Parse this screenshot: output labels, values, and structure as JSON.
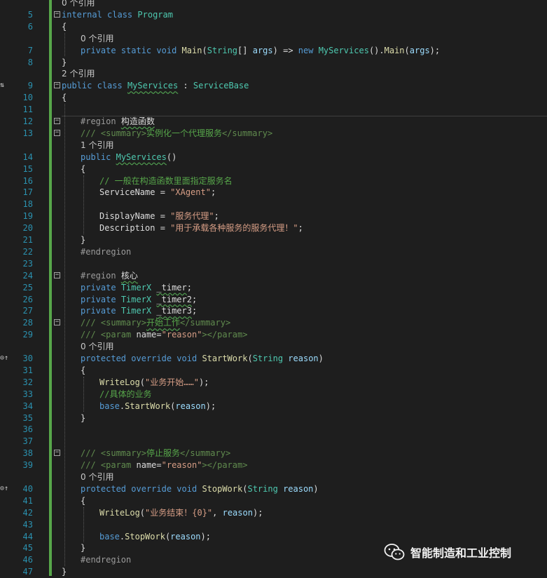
{
  "colors": {
    "background": "#1e1e1e",
    "line_number": "#2b91af",
    "keyword": "#569cd6",
    "type": "#4ec9b0",
    "plain": "#dcdcdc",
    "string": "#d69d85",
    "comment": "#57a64a",
    "xmldoc_tag": "#608b4e",
    "preprocessor": "#9b9b9b",
    "reference_hint": "#c8c8c8",
    "param": "#9cdcfe",
    "method": "#dcdcaa",
    "change_bar": "#57a64a"
  },
  "editor": {
    "gutter_markers": [
      {
        "row": 7,
        "text": "⇅"
      },
      {
        "row": 30,
        "text": "⊙↑"
      },
      {
        "row": 41,
        "text": "⊙↑"
      }
    ],
    "lines": [
      {
        "ln": "",
        "fold": "",
        "indent": 0,
        "tokens": [
          {
            "t": "0 个引用",
            "c": "ref"
          }
        ]
      },
      {
        "ln": "5",
        "fold": "−",
        "indent": 0,
        "tokens": [
          {
            "t": "internal",
            "c": "kw"
          },
          {
            "t": " "
          },
          {
            "t": "class",
            "c": "kw"
          },
          {
            "t": " "
          },
          {
            "t": "Program",
            "c": "type"
          }
        ]
      },
      {
        "ln": "6",
        "fold": "",
        "indent": 0,
        "tokens": [
          {
            "t": "{"
          }
        ]
      },
      {
        "ln": "",
        "fold": "",
        "indent": 1,
        "tokens": [
          {
            "t": "0 个引用",
            "c": "ref"
          }
        ]
      },
      {
        "ln": "7",
        "fold": "",
        "indent": 1,
        "tokens": [
          {
            "t": "private",
            "c": "kw"
          },
          {
            "t": " "
          },
          {
            "t": "static",
            "c": "kw"
          },
          {
            "t": " "
          },
          {
            "t": "void",
            "c": "kw"
          },
          {
            "t": " "
          },
          {
            "t": "Main",
            "c": "method"
          },
          {
            "t": "("
          },
          {
            "t": "String",
            "c": "type"
          },
          {
            "t": "[] "
          },
          {
            "t": "args",
            "c": "param"
          },
          {
            "t": ") => "
          },
          {
            "t": "new",
            "c": "kw"
          },
          {
            "t": " "
          },
          {
            "t": "MyServices",
            "c": "type"
          },
          {
            "t": "()."
          },
          {
            "t": "Main",
            "c": "method"
          },
          {
            "t": "("
          },
          {
            "t": "args",
            "c": "param"
          },
          {
            "t": ");"
          }
        ]
      },
      {
        "ln": "8",
        "fold": "",
        "indent": 0,
        "tokens": [
          {
            "t": "}"
          }
        ]
      },
      {
        "ln": "",
        "fold": "",
        "indent": 0,
        "tokens": [
          {
            "t": "2 个引用",
            "c": "ref"
          }
        ]
      },
      {
        "ln": "9",
        "fold": "−",
        "indent": 0,
        "tokens": [
          {
            "t": "public",
            "c": "kw"
          },
          {
            "t": " "
          },
          {
            "t": "class",
            "c": "kw"
          },
          {
            "t": " "
          },
          {
            "t": "MyServices",
            "c": "type squiggle"
          },
          {
            "t": " : "
          },
          {
            "t": "ServiceBase",
            "c": "type"
          }
        ]
      },
      {
        "ln": "10",
        "fold": "",
        "indent": 0,
        "tokens": [
          {
            "t": "{"
          }
        ]
      },
      {
        "ln": "11",
        "fold": "",
        "indent": 0,
        "tokens": []
      },
      {
        "ln": "12",
        "fold": "−",
        "indent": 1,
        "tokens": [
          {
            "t": "#region",
            "c": "pre"
          },
          {
            "t": " "
          },
          {
            "t": "构造函数",
            "c": "plain squiggle"
          }
        ]
      },
      {
        "ln": "13",
        "fold": "−",
        "indent": 1,
        "tokens": [
          {
            "t": "/// ",
            "c": "xml"
          },
          {
            "t": "<summary>",
            "c": "xml"
          },
          {
            "t": "实例化一个代理服务",
            "c": "comment"
          },
          {
            "t": "</summary>",
            "c": "xml"
          }
        ]
      },
      {
        "ln": "",
        "fold": "",
        "indent": 1,
        "tokens": [
          {
            "t": "1 个引用",
            "c": "ref"
          }
        ]
      },
      {
        "ln": "14",
        "fold": "",
        "indent": 1,
        "tokens": [
          {
            "t": "public",
            "c": "kw"
          },
          {
            "t": " "
          },
          {
            "t": "MyServices",
            "c": "type squiggle"
          },
          {
            "t": "()"
          }
        ]
      },
      {
        "ln": "15",
        "fold": "",
        "indent": 1,
        "tokens": [
          {
            "t": "{"
          }
        ]
      },
      {
        "ln": "16",
        "fold": "",
        "indent": 2,
        "tokens": [
          {
            "t": "// 一般在构造函数里面指定服务名",
            "c": "comment"
          }
        ]
      },
      {
        "ln": "17",
        "fold": "",
        "indent": 2,
        "tokens": [
          {
            "t": "ServiceName = "
          },
          {
            "t": "\"XAgent\"",
            "c": "str"
          },
          {
            "t": ";"
          }
        ]
      },
      {
        "ln": "18",
        "fold": "",
        "indent": 2,
        "tokens": []
      },
      {
        "ln": "19",
        "fold": "",
        "indent": 2,
        "tokens": [
          {
            "t": "DisplayName = "
          },
          {
            "t": "\"服务代理\"",
            "c": "str"
          },
          {
            "t": ";"
          }
        ]
      },
      {
        "ln": "20",
        "fold": "",
        "indent": 2,
        "tokens": [
          {
            "t": "Description = "
          },
          {
            "t": "\"用于承载各种服务的服务代理！\"",
            "c": "str"
          },
          {
            "t": ";"
          }
        ]
      },
      {
        "ln": "21",
        "fold": "",
        "indent": 1,
        "tokens": [
          {
            "t": "}"
          }
        ]
      },
      {
        "ln": "22",
        "fold": "",
        "indent": 1,
        "tokens": [
          {
            "t": "#endregion",
            "c": "pre"
          }
        ]
      },
      {
        "ln": "23",
        "fold": "",
        "indent": 1,
        "tokens": []
      },
      {
        "ln": "24",
        "fold": "−",
        "indent": 1,
        "tokens": [
          {
            "t": "#region",
            "c": "pre"
          },
          {
            "t": " "
          },
          {
            "t": "核心",
            "c": "plain squiggle"
          }
        ]
      },
      {
        "ln": "25",
        "fold": "",
        "indent": 1,
        "tokens": [
          {
            "t": "private",
            "c": "kw"
          },
          {
            "t": " "
          },
          {
            "t": "TimerX",
            "c": "type"
          },
          {
            "t": " "
          },
          {
            "t": "_timer",
            "c": "plain squiggle"
          },
          {
            "t": ";"
          }
        ]
      },
      {
        "ln": "26",
        "fold": "",
        "indent": 1,
        "tokens": [
          {
            "t": "private",
            "c": "kw"
          },
          {
            "t": " "
          },
          {
            "t": "TimerX",
            "c": "type"
          },
          {
            "t": " "
          },
          {
            "t": "_timer2",
            "c": "plain squiggle"
          },
          {
            "t": ";"
          }
        ]
      },
      {
        "ln": "27",
        "fold": "",
        "indent": 1,
        "tokens": [
          {
            "t": "private",
            "c": "kw"
          },
          {
            "t": " "
          },
          {
            "t": "TimerX",
            "c": "type"
          },
          {
            "t": " "
          },
          {
            "t": "_timer3",
            "c": "plain squiggle"
          },
          {
            "t": ";"
          }
        ]
      },
      {
        "ln": "28",
        "fold": "−",
        "indent": 1,
        "tokens": [
          {
            "t": "/// ",
            "c": "xml"
          },
          {
            "t": "<summary>",
            "c": "xml"
          },
          {
            "t": "开始工作",
            "c": "comment squiggle"
          },
          {
            "t": "</summary>",
            "c": "xml"
          }
        ]
      },
      {
        "ln": "29",
        "fold": "",
        "indent": 1,
        "tokens": [
          {
            "t": "/// ",
            "c": "xml"
          },
          {
            "t": "<param",
            "c": "xml"
          },
          {
            "t": " name=",
            "c": "plain"
          },
          {
            "t": "\"reason\"",
            "c": "str"
          },
          {
            "t": "></param>",
            "c": "xml"
          }
        ]
      },
      {
        "ln": "",
        "fold": "",
        "indent": 1,
        "tokens": [
          {
            "t": "0 个引用",
            "c": "ref"
          }
        ]
      },
      {
        "ln": "30",
        "fold": "",
        "indent": 1,
        "tokens": [
          {
            "t": "protected",
            "c": "kw"
          },
          {
            "t": " "
          },
          {
            "t": "override",
            "c": "kw"
          },
          {
            "t": " "
          },
          {
            "t": "void",
            "c": "kw"
          },
          {
            "t": " "
          },
          {
            "t": "StartWork",
            "c": "method"
          },
          {
            "t": "("
          },
          {
            "t": "String",
            "c": "type"
          },
          {
            "t": " "
          },
          {
            "t": "reason",
            "c": "param"
          },
          {
            "t": ")"
          }
        ]
      },
      {
        "ln": "31",
        "fold": "",
        "indent": 1,
        "tokens": [
          {
            "t": "{"
          }
        ]
      },
      {
        "ln": "32",
        "fold": "",
        "indent": 2,
        "tokens": [
          {
            "t": "WriteLog",
            "c": "method"
          },
          {
            "t": "("
          },
          {
            "t": "\"业务开始……\"",
            "c": "str"
          },
          {
            "t": ");"
          }
        ]
      },
      {
        "ln": "33",
        "fold": "",
        "indent": 2,
        "tokens": [
          {
            "t": "//具体的业务",
            "c": "comment"
          }
        ]
      },
      {
        "ln": "34",
        "fold": "",
        "indent": 2,
        "tokens": [
          {
            "t": "base",
            "c": "kw"
          },
          {
            "t": "."
          },
          {
            "t": "StartWork",
            "c": "method"
          },
          {
            "t": "("
          },
          {
            "t": "reason",
            "c": "param"
          },
          {
            "t": ");"
          }
        ]
      },
      {
        "ln": "35",
        "fold": "",
        "indent": 1,
        "tokens": [
          {
            "t": "}"
          }
        ]
      },
      {
        "ln": "36",
        "fold": "",
        "indent": 1,
        "tokens": []
      },
      {
        "ln": "37",
        "fold": "",
        "indent": 1,
        "tokens": []
      },
      {
        "ln": "38",
        "fold": "−",
        "indent": 1,
        "tokens": [
          {
            "t": "/// ",
            "c": "xml"
          },
          {
            "t": "<summary>",
            "c": "xml"
          },
          {
            "t": "停止服务",
            "c": "comment"
          },
          {
            "t": "</summary>",
            "c": "xml"
          }
        ]
      },
      {
        "ln": "39",
        "fold": "",
        "indent": 1,
        "tokens": [
          {
            "t": "/// ",
            "c": "xml"
          },
          {
            "t": "<param",
            "c": "xml"
          },
          {
            "t": " name=",
            "c": "plain"
          },
          {
            "t": "\"reason\"",
            "c": "str"
          },
          {
            "t": "></param>",
            "c": "xml"
          }
        ]
      },
      {
        "ln": "",
        "fold": "",
        "indent": 1,
        "tokens": [
          {
            "t": "0 个引用",
            "c": "ref"
          }
        ]
      },
      {
        "ln": "40",
        "fold": "",
        "indent": 1,
        "tokens": [
          {
            "t": "protected",
            "c": "kw"
          },
          {
            "t": " "
          },
          {
            "t": "override",
            "c": "kw"
          },
          {
            "t": " "
          },
          {
            "t": "void",
            "c": "kw"
          },
          {
            "t": " "
          },
          {
            "t": "StopWork",
            "c": "method"
          },
          {
            "t": "("
          },
          {
            "t": "String",
            "c": "type"
          },
          {
            "t": " "
          },
          {
            "t": "reason",
            "c": "param"
          },
          {
            "t": ")"
          }
        ]
      },
      {
        "ln": "41",
        "fold": "",
        "indent": 1,
        "tokens": [
          {
            "t": "{"
          }
        ]
      },
      {
        "ln": "42",
        "fold": "",
        "indent": 2,
        "tokens": [
          {
            "t": "WriteLog",
            "c": "method"
          },
          {
            "t": "("
          },
          {
            "t": "\"业务结束！{0}\"",
            "c": "str"
          },
          {
            "t": ", "
          },
          {
            "t": "reason",
            "c": "param"
          },
          {
            "t": ");"
          }
        ]
      },
      {
        "ln": "43",
        "fold": "",
        "indent": 2,
        "tokens": []
      },
      {
        "ln": "44",
        "fold": "",
        "indent": 2,
        "tokens": [
          {
            "t": "base",
            "c": "kw"
          },
          {
            "t": "."
          },
          {
            "t": "StopWork",
            "c": "method"
          },
          {
            "t": "("
          },
          {
            "t": "reason",
            "c": "param"
          },
          {
            "t": ");"
          }
        ]
      },
      {
        "ln": "45",
        "fold": "",
        "indent": 1,
        "tokens": [
          {
            "t": "}"
          }
        ]
      },
      {
        "ln": "46",
        "fold": "",
        "indent": 1,
        "tokens": [
          {
            "t": "#endregion",
            "c": "pre"
          }
        ]
      },
      {
        "ln": "47",
        "fold": "",
        "indent": 0,
        "tokens": [
          {
            "t": "}"
          }
        ]
      }
    ]
  },
  "watermark": {
    "icon": "wechat-icon",
    "text": "智能制造和工业控制"
  }
}
